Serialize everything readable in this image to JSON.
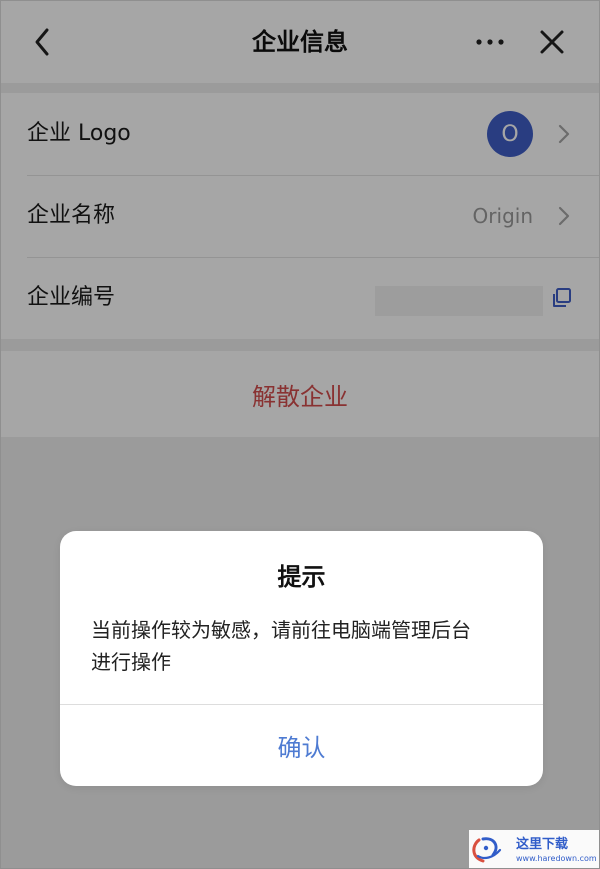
{
  "header": {
    "title": "企业信息"
  },
  "icons": {
    "back": "chevron-left-icon",
    "more": "more-horizontal-icon",
    "close": "close-icon",
    "row_arrow": "chevron-right-icon",
    "copy": "copy-icon",
    "watermark": "site-watermark-logo"
  },
  "settings": {
    "logo_label": "企业 Logo",
    "logo_initial": "O",
    "name_label": "企业名称",
    "name_value": "Origin",
    "number_label": "企业编号"
  },
  "actions": {
    "dissolve_label": "解散企业"
  },
  "dialog": {
    "title": "提示",
    "message": "当前操作较为敏感，请前往电脑端管理后台\n进行操作",
    "confirm_label": "确认"
  },
  "watermark": {
    "brand": "这里下载",
    "url": "www.haredown.com"
  },
  "colors": {
    "accent_blue": "#3f5fc7",
    "danger_red": "#d34d4d",
    "dialog_action_blue": "#4e7bd2"
  }
}
